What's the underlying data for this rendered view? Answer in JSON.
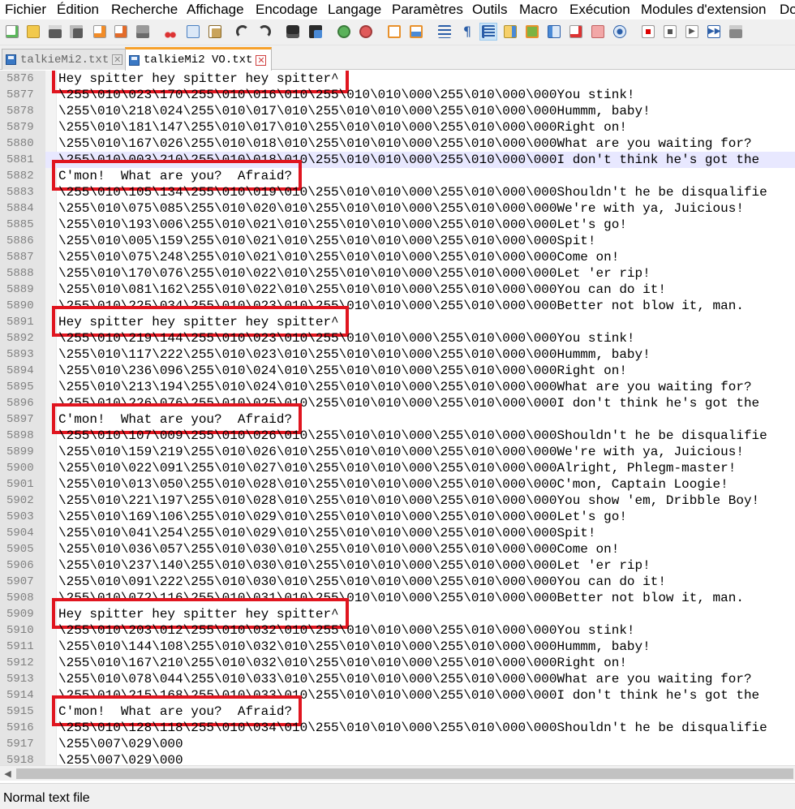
{
  "menu": [
    "Fichier",
    "Édition",
    "Recherche",
    "Affichage",
    "Encodage",
    "Langage",
    "Paramètres",
    "Outils",
    "Macro",
    "Exécution",
    "Modules d'extension",
    "Do"
  ],
  "toolbar": {
    "icons": [
      "new-file-icon",
      "open-file-icon",
      "save-icon",
      "save-all-icon",
      "close-icon",
      "close-all-icon",
      "print-icon",
      "cut-icon",
      "copy-icon",
      "paste-icon",
      "undo-icon",
      "redo-icon",
      "find-icon",
      "replace-icon",
      "zoom-in-icon",
      "zoom-out-icon",
      "sync-v-icon",
      "sync-h-icon",
      "word-wrap-icon",
      "show-all-chars-icon",
      "indent-guide-icon",
      "doc-map-icon",
      "function-list-icon",
      "folder-workspace-icon",
      "monitoring-icon",
      "record-macro-icon",
      "stop-macro-icon",
      "play-macro-icon",
      "run-macro-multiple-icon",
      "save-macro-icon"
    ]
  },
  "tabs": [
    {
      "label": "talkieMi2.txt",
      "active": false
    },
    {
      "label": "talkieMi2 VO.txt",
      "active": true
    }
  ],
  "editor": {
    "lines": [
      {
        "n": "5876",
        "text": "Hey spitter hey spitter hey spitter^"
      },
      {
        "n": "5877",
        "text": "\\255\\010\\023\\170\\255\\010\\016\\010\\255\\010\\010\\000\\255\\010\\000\\000You stink!"
      },
      {
        "n": "5878",
        "text": "\\255\\010\\218\\024\\255\\010\\017\\010\\255\\010\\010\\000\\255\\010\\000\\000Hummm, baby!"
      },
      {
        "n": "5879",
        "text": "\\255\\010\\181\\147\\255\\010\\017\\010\\255\\010\\010\\000\\255\\010\\000\\000Right on!"
      },
      {
        "n": "5880",
        "text": "\\255\\010\\167\\026\\255\\010\\018\\010\\255\\010\\010\\000\\255\\010\\000\\000What are you waiting for?"
      },
      {
        "n": "5881",
        "text": "\\255\\010\\003\\210\\255\\010\\018\\010\\255\\010\\010\\000\\255\\010\\000\\000I don't think he's got the"
      },
      {
        "n": "5882",
        "text": "C'mon!  What are you?  Afraid?"
      },
      {
        "n": "5883",
        "text": "\\255\\010\\105\\134\\255\\010\\019\\010\\255\\010\\010\\000\\255\\010\\000\\000Shouldn't he be disqualifie"
      },
      {
        "n": "5884",
        "text": "\\255\\010\\075\\085\\255\\010\\020\\010\\255\\010\\010\\000\\255\\010\\000\\000We're with ya, Juicious!"
      },
      {
        "n": "5885",
        "text": "\\255\\010\\193\\006\\255\\010\\021\\010\\255\\010\\010\\000\\255\\010\\000\\000Let's go!"
      },
      {
        "n": "5886",
        "text": "\\255\\010\\005\\159\\255\\010\\021\\010\\255\\010\\010\\000\\255\\010\\000\\000Spit!"
      },
      {
        "n": "5887",
        "text": "\\255\\010\\075\\248\\255\\010\\021\\010\\255\\010\\010\\000\\255\\010\\000\\000Come on!"
      },
      {
        "n": "5888",
        "text": "\\255\\010\\170\\076\\255\\010\\022\\010\\255\\010\\010\\000\\255\\010\\000\\000Let 'er rip!"
      },
      {
        "n": "5889",
        "text": "\\255\\010\\081\\162\\255\\010\\022\\010\\255\\010\\010\\000\\255\\010\\000\\000You can do it!"
      },
      {
        "n": "5890",
        "text": "\\255\\010\\225\\034\\255\\010\\023\\010\\255\\010\\010\\000\\255\\010\\000\\000Better not blow it, man."
      },
      {
        "n": "5891",
        "text": "Hey spitter hey spitter hey spitter^"
      },
      {
        "n": "5892",
        "text": "\\255\\010\\219\\144\\255\\010\\023\\010\\255\\010\\010\\000\\255\\010\\000\\000You stink!"
      },
      {
        "n": "5893",
        "text": "\\255\\010\\117\\222\\255\\010\\023\\010\\255\\010\\010\\000\\255\\010\\000\\000Hummm, baby!"
      },
      {
        "n": "5894",
        "text": "\\255\\010\\236\\096\\255\\010\\024\\010\\255\\010\\010\\000\\255\\010\\000\\000Right on!"
      },
      {
        "n": "5895",
        "text": "\\255\\010\\213\\194\\255\\010\\024\\010\\255\\010\\010\\000\\255\\010\\000\\000What are you waiting for?"
      },
      {
        "n": "5896",
        "text": "\\255\\010\\226\\076\\255\\010\\025\\010\\255\\010\\010\\000\\255\\010\\000\\000I don't think he's got the"
      },
      {
        "n": "5897",
        "text": "C'mon!  What are you?  Afraid?"
      },
      {
        "n": "5898",
        "text": "\\255\\010\\107\\009\\255\\010\\026\\010\\255\\010\\010\\000\\255\\010\\000\\000Shouldn't he be disqualifie"
      },
      {
        "n": "5899",
        "text": "\\255\\010\\159\\219\\255\\010\\026\\010\\255\\010\\010\\000\\255\\010\\000\\000We're with ya, Juicious!"
      },
      {
        "n": "5900",
        "text": "\\255\\010\\022\\091\\255\\010\\027\\010\\255\\010\\010\\000\\255\\010\\000\\000Alright, Phlegm-master!"
      },
      {
        "n": "5901",
        "text": "\\255\\010\\013\\050\\255\\010\\028\\010\\255\\010\\010\\000\\255\\010\\000\\000C'mon, Captain Loogie!"
      },
      {
        "n": "5902",
        "text": "\\255\\010\\221\\197\\255\\010\\028\\010\\255\\010\\010\\000\\255\\010\\000\\000You show 'em, Dribble Boy!"
      },
      {
        "n": "5903",
        "text": "\\255\\010\\169\\106\\255\\010\\029\\010\\255\\010\\010\\000\\255\\010\\000\\000Let's go!"
      },
      {
        "n": "5904",
        "text": "\\255\\010\\041\\254\\255\\010\\029\\010\\255\\010\\010\\000\\255\\010\\000\\000Spit!"
      },
      {
        "n": "5905",
        "text": "\\255\\010\\036\\057\\255\\010\\030\\010\\255\\010\\010\\000\\255\\010\\000\\000Come on!"
      },
      {
        "n": "5906",
        "text": "\\255\\010\\237\\140\\255\\010\\030\\010\\255\\010\\010\\000\\255\\010\\000\\000Let 'er rip!"
      },
      {
        "n": "5907",
        "text": "\\255\\010\\091\\222\\255\\010\\030\\010\\255\\010\\010\\000\\255\\010\\000\\000You can do it!"
      },
      {
        "n": "5908",
        "text": "\\255\\010\\072\\116\\255\\010\\031\\010\\255\\010\\010\\000\\255\\010\\000\\000Better not blow it, man."
      },
      {
        "n": "5909",
        "text": "Hey spitter hey spitter hey spitter^"
      },
      {
        "n": "5910",
        "text": "\\255\\010\\203\\012\\255\\010\\032\\010\\255\\010\\010\\000\\255\\010\\000\\000You stink!"
      },
      {
        "n": "5911",
        "text": "\\255\\010\\144\\108\\255\\010\\032\\010\\255\\010\\010\\000\\255\\010\\000\\000Hummm, baby!"
      },
      {
        "n": "5912",
        "text": "\\255\\010\\167\\210\\255\\010\\032\\010\\255\\010\\010\\000\\255\\010\\000\\000Right on!"
      },
      {
        "n": "5913",
        "text": "\\255\\010\\078\\044\\255\\010\\033\\010\\255\\010\\010\\000\\255\\010\\000\\000What are you waiting for?"
      },
      {
        "n": "5914",
        "text": "\\255\\010\\215\\168\\255\\010\\033\\010\\255\\010\\010\\000\\255\\010\\000\\000I don't think he's got the"
      },
      {
        "n": "5915",
        "text": "C'mon!  What are you?  Afraid?"
      },
      {
        "n": "5916",
        "text": "\\255\\010\\128\\118\\255\\010\\034\\010\\255\\010\\010\\000\\255\\010\\000\\000Shouldn't he be disqualifie"
      },
      {
        "n": "5917",
        "text": "\\255\\007\\029\\000"
      },
      {
        "n": "5918",
        "text": "\\255\\007\\029\\000"
      }
    ],
    "current_line": "5881",
    "highlight_color": "#e0151f",
    "highlighted_lines": [
      "5876",
      "5882",
      "5891",
      "5897",
      "5909",
      "5915"
    ]
  },
  "status": {
    "file_type": "Normal text file"
  }
}
